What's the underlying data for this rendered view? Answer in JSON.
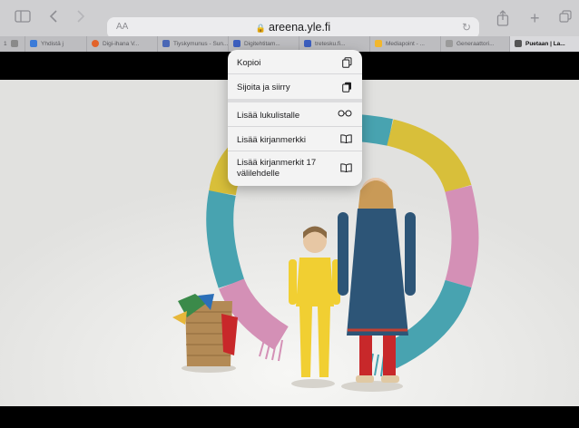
{
  "browser": {
    "toolbar": {
      "sidebar_icon": "sidebar-icon",
      "back_icon": "chevron-left-icon",
      "forward_icon": "chevron-right-icon",
      "share_icon": "share-icon",
      "new_tab_icon": "plus-icon",
      "tabs_overview_icon": "tabs-overview-icon"
    },
    "address_bar": {
      "text_size_label": "AA",
      "domain": "areena.yle.fi",
      "reload_icon": "reload-icon"
    },
    "tabs": [
      {
        "label": "1",
        "favicon_color": "#8a8a8a"
      },
      {
        "label": "Yhdistä j",
        "favicon_color": "#3b7bd8"
      },
      {
        "label": "Digi-ihana V...",
        "favicon_color": "#e2632a"
      },
      {
        "label": "Tiyskymunus - Sun...",
        "favicon_color": "#4a67b5"
      },
      {
        "label": "Digitehtitam...",
        "favicon_color": "#3d5fbf"
      },
      {
        "label": "tretesku.fi...",
        "favicon_color": "#3d5fbf"
      },
      {
        "label": "Mediapoint - ...",
        "favicon_color": "#f2b72d"
      },
      {
        "label": "Generaattori...",
        "favicon_color": "#9a9a9a"
      },
      {
        "label": "Puetaan | La...",
        "favicon_color": "#555555",
        "active": true
      }
    ]
  },
  "context_menu": {
    "items": [
      {
        "label": "Kopioi",
        "icon": "copy-icon"
      },
      {
        "label": "Sijoita ja siirry",
        "icon": "paste-and-go-icon"
      },
      {
        "label": "Lisää lukulistalle",
        "icon": "reading-list-glasses-icon"
      },
      {
        "label": "Lisää kirjanmerkki",
        "icon": "bookmark-book-icon"
      },
      {
        "label": "Lisää kirjanmerkit 17 välilehdelle",
        "icon": "bookmark-book-icon"
      }
    ]
  },
  "colors": {
    "toolbar_bg": "#cfcfd1",
    "video_bg": "#e7e7e5",
    "ring_teal": "#48a3b0",
    "ring_yellow": "#d8bf3a",
    "ring_pink": "#d490b6",
    "girl_yellow_outfit": "#f1cf32",
    "dress_blue": "#2d5577",
    "tights_red": "#c8282a"
  }
}
